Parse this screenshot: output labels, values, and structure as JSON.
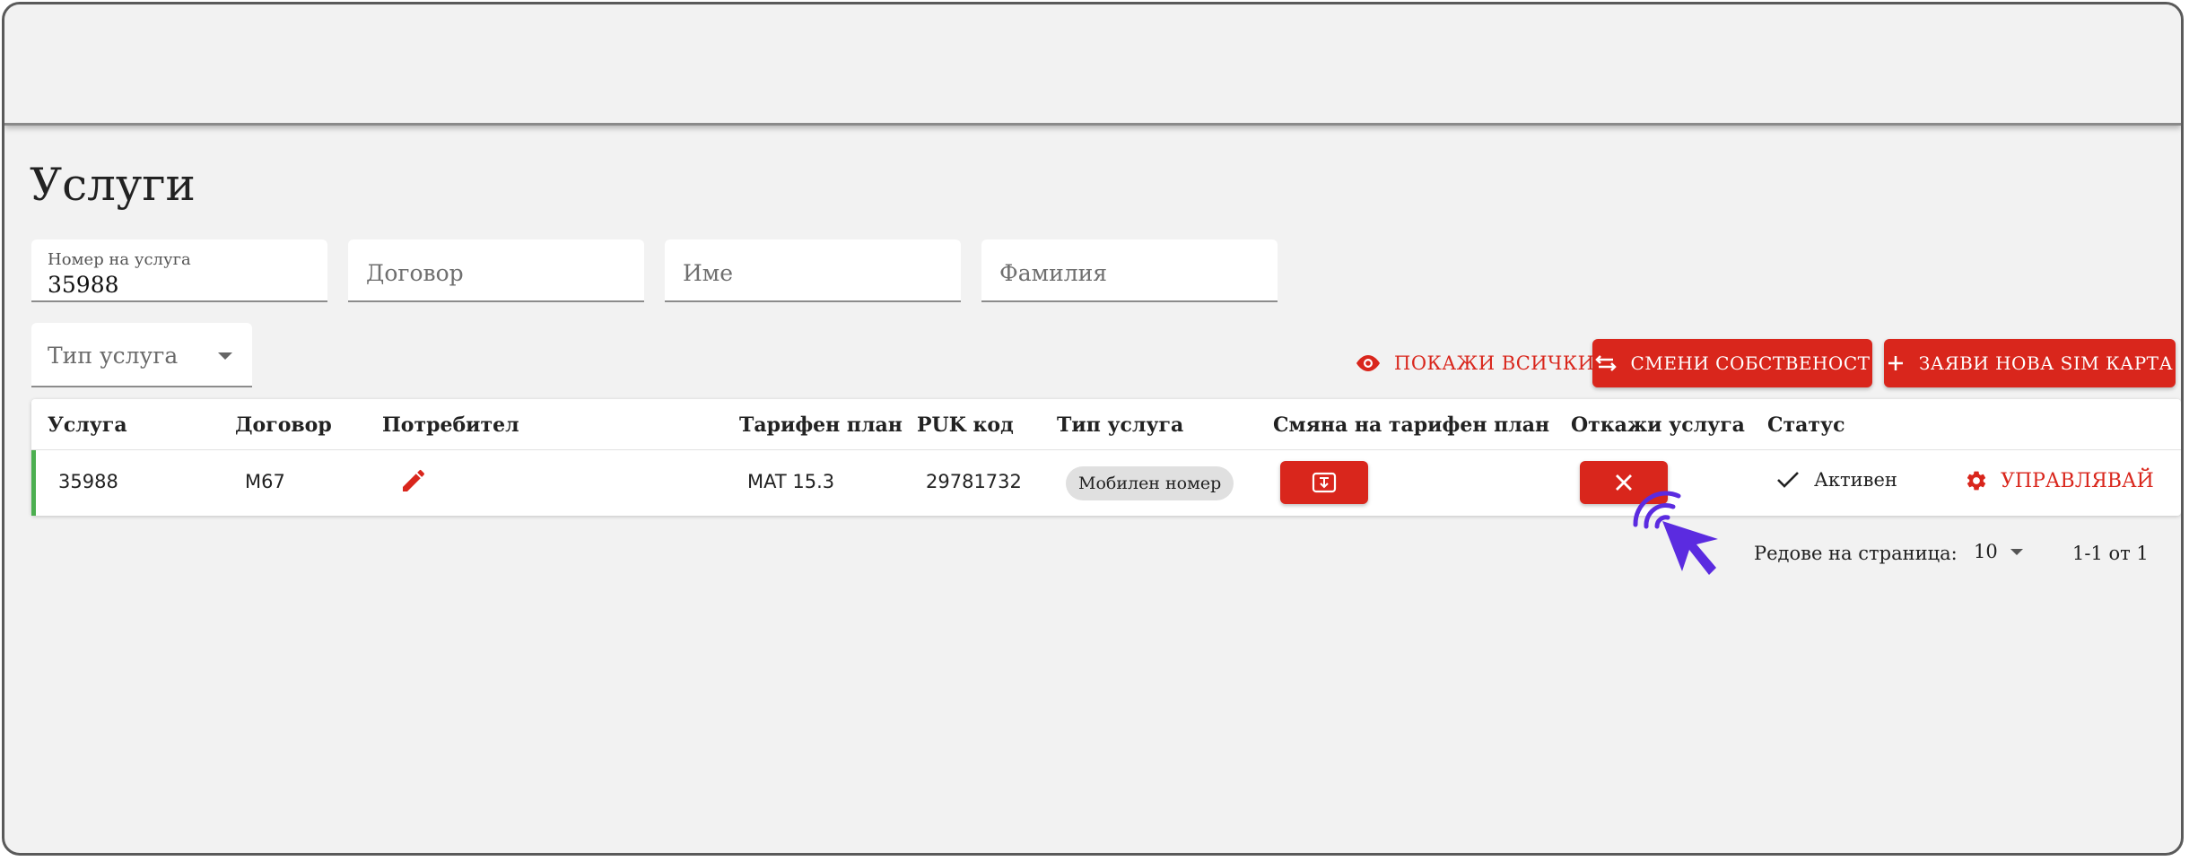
{
  "page": {
    "title": "Услуги"
  },
  "filters": {
    "service_number": {
      "label": "Номер на услуга",
      "value": "35988"
    },
    "contract": {
      "placeholder": "Договор"
    },
    "first_name": {
      "placeholder": "Име"
    },
    "last_name": {
      "placeholder": "Фамилия"
    },
    "service_type": {
      "label": "Тип услуга"
    }
  },
  "actions": {
    "show_all": "ПОКАЖИ ВСИЧКИ",
    "change_owner": "СМЕНИ СОБСТВЕНОСТ",
    "new_sim": "ЗАЯВИ НОВА SIM КАРТА"
  },
  "table": {
    "columns": [
      "Услуга",
      "Договор",
      "Потребител",
      "Тарифен план",
      "PUK код",
      "Тип услуга",
      "Смяна на тарифен план",
      "Откажи услуга",
      "Статус"
    ],
    "rows": [
      {
        "service": "35988",
        "contract": "M67",
        "tariff": "MAT 15.3",
        "puk": "29781732",
        "type": "Мобилен номер",
        "status": "Активен",
        "manage": "УПРАВЛЯВАЙ"
      }
    ]
  },
  "pagination": {
    "rows_per_page_label": "Редове на страница:",
    "rows_per_page": "10",
    "range": "1-1 от 1"
  },
  "colors": {
    "accent": "#d9261c",
    "active": "#4caf50",
    "cursor": "#5b2be0"
  },
  "icons": [
    "eye-icon",
    "swap-icon",
    "plus-icon",
    "pencil-icon",
    "tariff-change-icon",
    "close-icon",
    "check-icon",
    "gear-icon",
    "pointer-cursor-icon"
  ]
}
